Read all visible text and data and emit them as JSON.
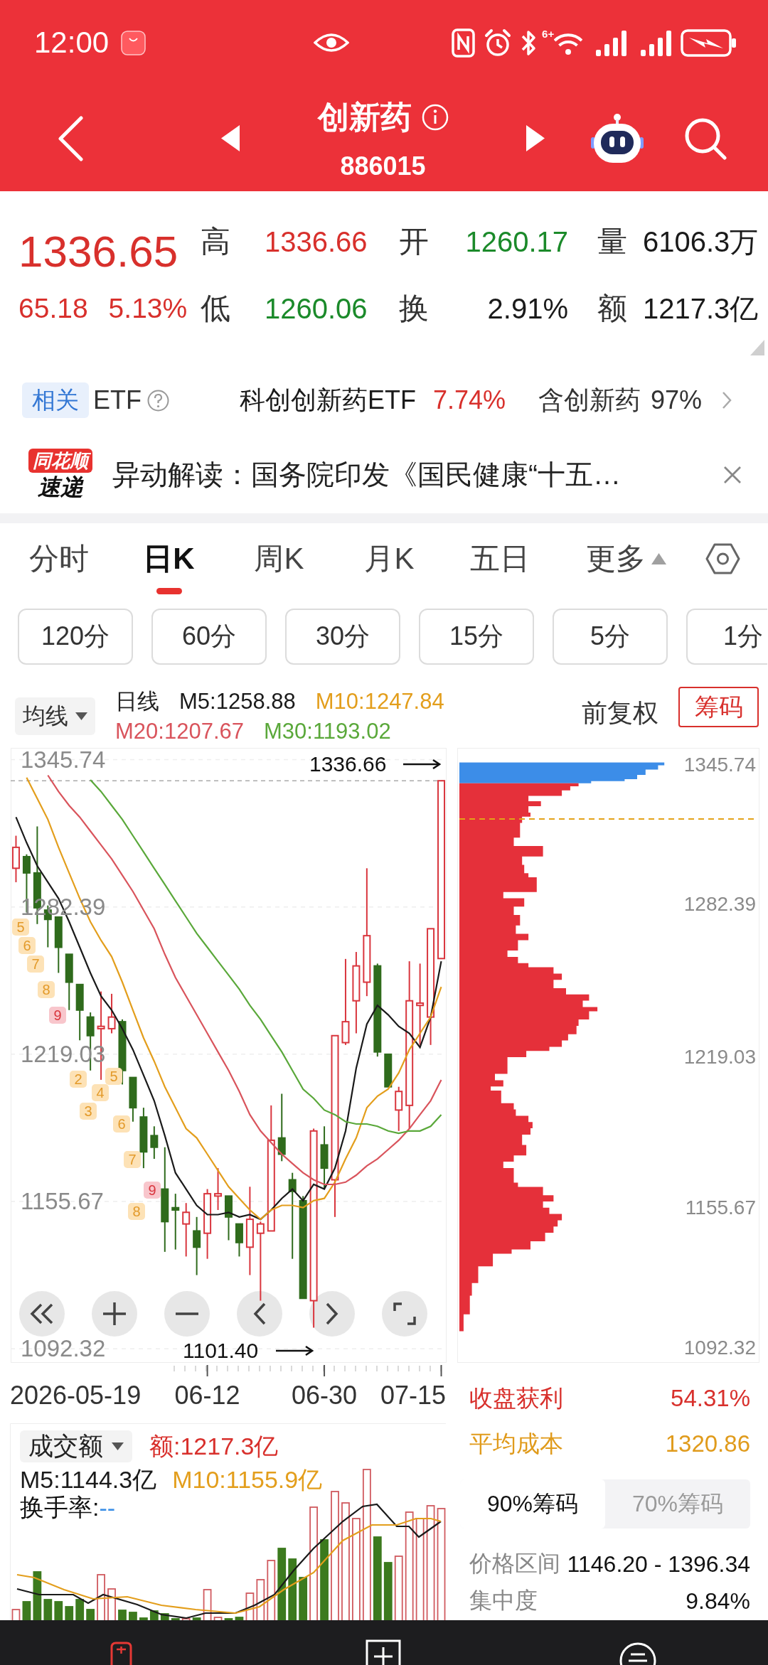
{
  "status_bar": {
    "time": "12:00",
    "wifi_label": "6+"
  },
  "header": {
    "title": "创新药",
    "code": "886015"
  },
  "quote": {
    "price": "1336.65",
    "change": "65.18",
    "change_percent": "5.13%",
    "rising": true,
    "stats": [
      {
        "label": "高",
        "value": "1336.66",
        "color": "#d8302c"
      },
      {
        "label": "开",
        "value": "1260.17",
        "color": "#1b8a2a"
      },
      {
        "label": "量",
        "value": "6106.3万",
        "color": "#1a1a1a"
      },
      {
        "label": "低",
        "value": "1260.06",
        "color": "#1b8a2a"
      },
      {
        "label": "换",
        "value": "2.91%",
        "color": "#1a1a1a"
      },
      {
        "label": "额",
        "value": "1217.3亿",
        "color": "#1a1a1a"
      }
    ]
  },
  "related": {
    "tag": "相关",
    "label": "ETF",
    "fund": "科创创新药ETF",
    "fund_change": "7.74%",
    "holding_label": "含创新药",
    "holding_percent": "97%"
  },
  "news": {
    "source_top": "同花顺",
    "source_bottom": "速递",
    "text": "异动解读：国务院印发《国民健康“十五…"
  },
  "period_tabs": [
    {
      "label": "分时",
      "kind": "tab",
      "selected": false
    },
    {
      "label": "日K",
      "kind": "tab",
      "selected": true
    },
    {
      "label": "周K",
      "kind": "tab",
      "selected": false
    },
    {
      "label": "月K",
      "kind": "tab",
      "selected": false
    },
    {
      "label": "五日",
      "kind": "tab",
      "selected": false
    },
    {
      "label": "更多",
      "kind": "menu",
      "selected": false
    }
  ],
  "intervals": [
    {
      "label": "120分",
      "selected": false
    },
    {
      "label": "60分",
      "selected": false
    },
    {
      "label": "30分",
      "selected": false
    },
    {
      "label": "15分",
      "selected": false
    },
    {
      "label": "5分",
      "selected": false
    },
    {
      "label": "1分",
      "selected": false
    }
  ],
  "chart": {
    "ma_toggle": "均线",
    "line_label": "日线",
    "adjust": "前复权",
    "chips_button": {
      "label": "筹码",
      "selected": true
    },
    "low_label": "1101.40",
    "range_start": "2026-05-19",
    "range_end": "07-15",
    "markers": [
      {
        "label": "5",
        "kind": "setup"
      },
      {
        "label": "6",
        "kind": "setup"
      },
      {
        "label": "7",
        "kind": "setup"
      },
      {
        "label": "8",
        "kind": "setup"
      },
      {
        "label": "9",
        "kind": "signal"
      },
      {
        "label": "2",
        "kind": "setup"
      },
      {
        "label": "3",
        "kind": "setup"
      },
      {
        "label": "4",
        "kind": "setup"
      },
      {
        "label": "5",
        "kind": "setup"
      },
      {
        "label": "6",
        "kind": "setup"
      },
      {
        "label": "7",
        "kind": "setup"
      },
      {
        "label": "8",
        "kind": "setup"
      },
      {
        "label": "9",
        "kind": "signal"
      }
    ],
    "chart_data": {
      "type": "candlestick",
      "categories": [
        null,
        null,
        null,
        null,
        null,
        null,
        null,
        null,
        null,
        null,
        null,
        null,
        null,
        null,
        null,
        null,
        null,
        null,
        "06-12",
        null,
        null,
        null,
        null,
        null,
        null,
        null,
        null,
        null,
        null,
        "06-30",
        null,
        null,
        null,
        null,
        null,
        null,
        null,
        null,
        null,
        null,
        null
      ],
      "ohlc": [
        [
          1299,
          1313,
          1293,
          1308
        ],
        [
          1304,
          1305,
          1280,
          1297
        ],
        [
          1297,
          1317,
          1275,
          1282
        ],
        [
          1281,
          1283,
          1265,
          1277
        ],
        [
          1278,
          1278,
          1254,
          1265
        ],
        [
          1262,
          1262,
          1238,
          1250
        ],
        [
          1249,
          1249,
          1225,
          1238
        ],
        [
          1235,
          1237,
          1212,
          1227
        ],
        [
          1230,
          1246,
          1208,
          1231
        ],
        [
          1230,
          1245,
          1228,
          1235
        ],
        [
          1233,
          1234,
          1206,
          1212
        ],
        [
          1209,
          1209,
          1190,
          1196
        ],
        [
          1192,
          1196,
          1170,
          1177
        ],
        [
          1184,
          1188,
          1174,
          1179
        ],
        [
          1161,
          1179,
          1134,
          1147
        ],
        [
          1153,
          1159,
          1135,
          1152
        ],
        [
          1146,
          1155,
          1132,
          1151
        ],
        [
          1143,
          1149,
          1124,
          1136
        ],
        [
          1142,
          1161,
          1131,
          1159
        ],
        [
          1158,
          1170,
          1152,
          1159
        ],
        [
          1158,
          1158,
          1139,
          1149
        ],
        [
          1146,
          1146,
          1132,
          1138
        ],
        [
          1136,
          1162,
          1124,
          1148
        ],
        [
          1142,
          1147,
          1113,
          1146
        ],
        [
          1143,
          1197,
          1143,
          1182
        ],
        [
          1183,
          1202,
          1173,
          1176
        ],
        [
          1165,
          1168,
          1131,
          1160
        ],
        [
          1156,
          1158,
          1114,
          1114
        ],
        [
          1113,
          1187,
          1101.4,
          1186
        ],
        [
          1180,
          1188,
          1161,
          1170
        ],
        [
          1165,
          1227,
          1149,
          1227
        ],
        [
          1224,
          1260,
          1223,
          1233
        ],
        [
          1242,
          1263,
          1228,
          1257
        ],
        [
          1250,
          1299,
          1244,
          1270
        ],
        [
          1257,
          1258,
          1218,
          1220
        ],
        [
          1219,
          1219,
          1205,
          1205
        ],
        [
          1195,
          1205,
          1186,
          1203
        ],
        [
          1197,
          1259,
          1187,
          1242
        ],
        [
          1240,
          1258,
          1223,
          1241
        ],
        [
          1235,
          1273,
          1223,
          1273
        ],
        [
          1260.17,
          1336.66,
          1260.06,
          1336.65
        ]
      ],
      "series": [
        {
          "name": "M5:1258.88",
          "type": "line",
          "color": "#1a1a1a",
          "values": [
            1321,
            1310,
            1300,
            1293,
            1286,
            1276,
            1265,
            1254,
            1244,
            1238,
            1230,
            1221,
            1210,
            1199,
            1184,
            1168,
            1161,
            1154,
            1150,
            1150,
            1151,
            1149,
            1150,
            1148,
            1152,
            1157,
            1161,
            1156,
            1163,
            1161,
            1170,
            1186,
            1213,
            1232,
            1240,
            1236,
            1231,
            1228,
            1222,
            1235,
            1259
          ]
        },
        {
          "name": "M10:1247.84",
          "type": "line",
          "color": "#e39e1c",
          "values": [
            null,
            1338,
            1329,
            1320,
            1308,
            1297,
            1286,
            1276,
            1268,
            1261,
            1250,
            1238,
            1226,
            1216,
            1205,
            1196,
            1187,
            1183,
            1176,
            1169,
            1162,
            1157,
            1152,
            1148,
            1152,
            1154,
            1154,
            1153,
            1156,
            1157,
            1164,
            1174,
            1183,
            1196,
            1201,
            1204,
            1211,
            1221,
            1228,
            1235,
            1248
          ]
        },
        {
          "name": "M20:1207.67",
          "type": "line",
          "color": "#d9545c",
          "values": [
            null,
            null,
            null,
            1339,
            1332,
            1326,
            1321,
            1315,
            1309,
            1303,
            1296,
            1289,
            1281,
            1273,
            1262,
            1252,
            1244,
            1236,
            1228,
            1220,
            1212,
            1203,
            1193,
            1186,
            1181,
            1176,
            1172,
            1168,
            1165,
            1163,
            1163,
            1164,
            1167,
            1171,
            1174,
            1178,
            1182,
            1187,
            1193,
            1199,
            1208
          ]
        },
        {
          "name": "M30:1193.02",
          "type": "line",
          "color": "#5aa83a",
          "values": [
            null,
            null,
            null,
            null,
            null,
            null,
            null,
            1337,
            1332,
            1326,
            1320,
            1313,
            1306,
            1299,
            1292,
            1285,
            1278,
            1271,
            1265,
            1259,
            1253,
            1247,
            1240,
            1234,
            1227,
            1220,
            1212,
            1204,
            1200,
            1195,
            1193,
            1190,
            1189,
            1189,
            1188,
            1186,
            1185,
            1186,
            1186,
            1188,
            1193
          ]
        }
      ],
      "ylim": [
        1086.25,
        1350.78
      ],
      "yticks": [
        1345.74,
        1282.39,
        1219.03,
        1155.67,
        1092.32
      ],
      "grid": true,
      "ref_lines": [
        {
          "axis": "y",
          "value": 1336.66,
          "label": "1336.66"
        }
      ]
    }
  },
  "chips": {
    "y_labels": [
      "1345.74",
      "1282.39",
      "1219.03",
      "1155.67",
      "1092.32"
    ],
    "profit_label": "收盘获利",
    "profit_value": "54.31%",
    "avg_label": "平均成本",
    "avg_value": "1320.86",
    "tabs": [
      {
        "label": "90%筹码",
        "selected": true
      },
      {
        "label": "70%筹码",
        "selected": false
      }
    ],
    "range_label": "价格区间",
    "range_value": "1146.20 - 1396.34",
    "concentration_label": "集中度",
    "concentration_value": "9.84%"
  },
  "volume": {
    "toggle": "成交额",
    "amount": "额:1217.3亿",
    "ma": [
      {
        "label": "M5:1144.3亿",
        "color": "#1a1a1a"
      },
      {
        "label": "M10:1155.9亿",
        "color": "#e39e1c"
      }
    ],
    "turnover_label": "换手率:",
    "turnover_value": "--"
  }
}
